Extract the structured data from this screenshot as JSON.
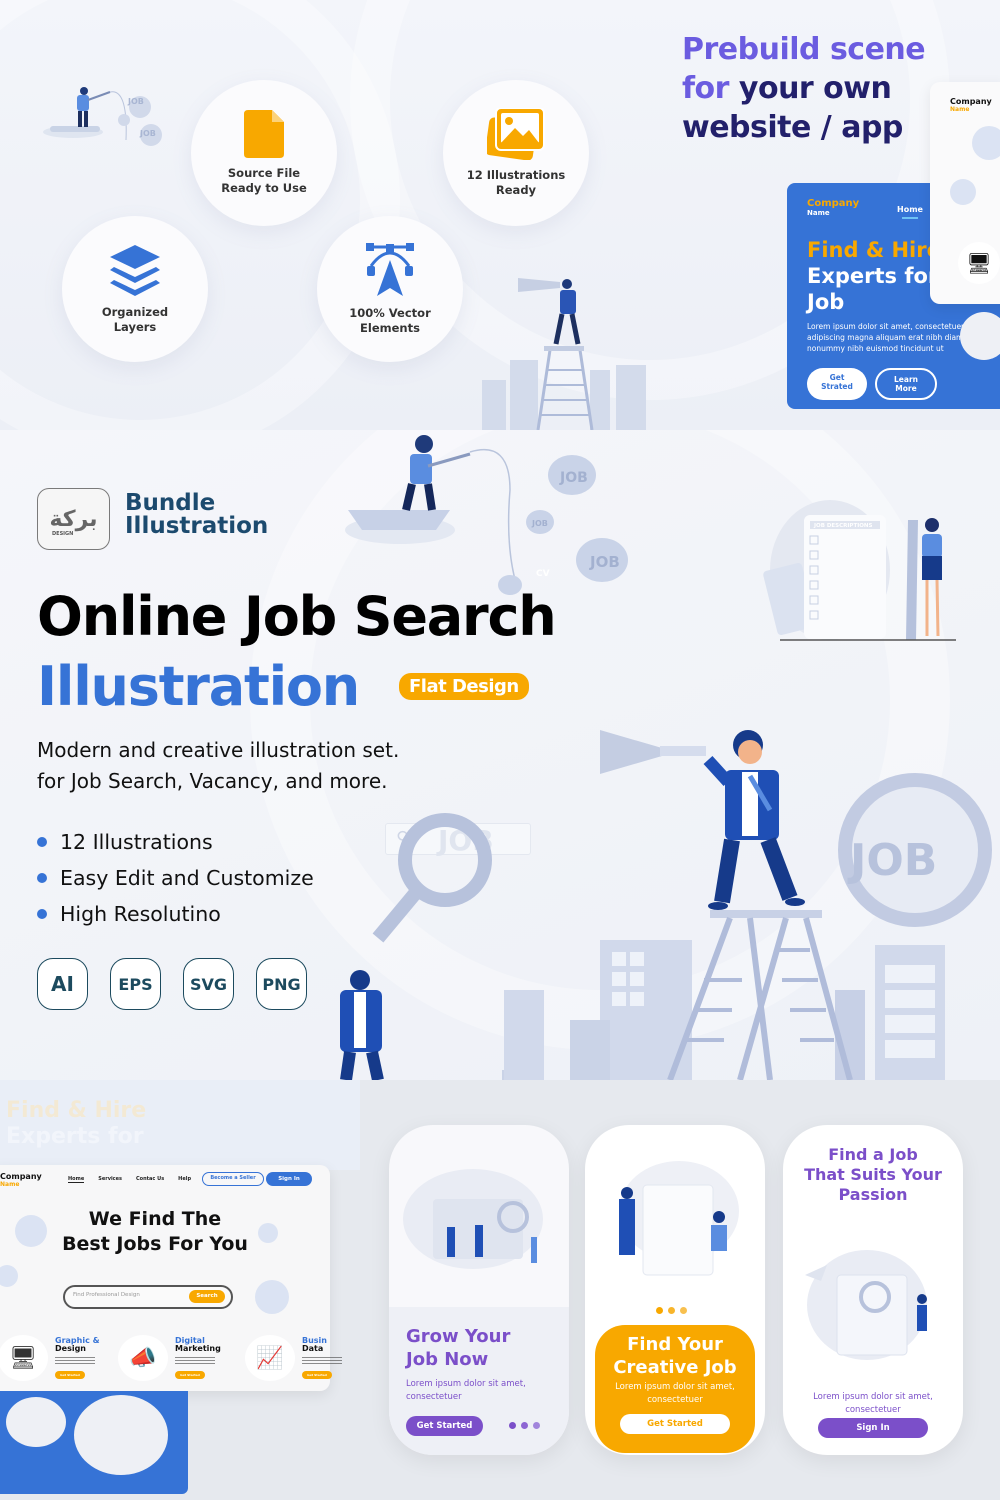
{
  "features": [
    {
      "icon": "file-icon",
      "line1": "Source File",
      "line2": "Ready to Use",
      "color": "#f8a800"
    },
    {
      "icon": "image-icon",
      "line1": "12 Illustrations",
      "line2": "Ready",
      "color": "#f8a800"
    },
    {
      "icon": "layers-icon",
      "line1": "Organized",
      "line2": "Layers",
      "color": "#3673d6"
    },
    {
      "icon": "vector-pen-icon",
      "line1": "100% Vector",
      "line2": "Elements",
      "color": "#3673d6"
    }
  ],
  "prebuild": {
    "line1": "Prebuild scene",
    "line2_accent": "for",
    "line2_rest": " your own",
    "line3": "website / app"
  },
  "hero_card": {
    "company": "Company",
    "company_sub": "Name",
    "nav_home": "Home",
    "title_orange": "Find & Hire",
    "title_white": "Experts for any Job",
    "body": "Lorem ipsum dolor sit amet, consectetuer adipiscing magna aliquam erat nibh diam nonummy nibh euismod tincidunt ut",
    "btn_primary": "Get Strated",
    "btn_secondary": "Learn More"
  },
  "side_card": {
    "company": "Company",
    "company_sub": "Name"
  },
  "brand": {
    "logo_glyph": "بركة",
    "logo_sub": "DESIGN",
    "line1": "Bundle",
    "line2": "Illustration"
  },
  "main": {
    "title": "Online Job Search",
    "subtitle": "Illustration",
    "badge": "Flat Design",
    "desc_line1": "Modern and creative illustration set.",
    "desc_line2": "for Job Search, Vacancy, and more.",
    "bullets": [
      "12 Illustrations",
      "Easy Edit and Customize",
      "High Resolutino"
    ],
    "formats": [
      "AI",
      "EPS",
      "SVG",
      "PNG"
    ]
  },
  "illustration_labels": {
    "job": "JOB",
    "cv": "CV",
    "job_descriptions": "JOB DESCRIPTIONS",
    "search_job": "JOB"
  },
  "website": {
    "company": "Company",
    "company_sub": "Name",
    "nav": [
      "Home",
      "Services",
      "Contac Us",
      "Help"
    ],
    "btn_seller": "Become a Seller",
    "btn_signin": "Sign In",
    "title_line1": "We Find The",
    "title_line2": "Best Jobs For You",
    "search_placeholder": "Find Professional Design",
    "search_btn": "Search",
    "categories": [
      {
        "t1": "Graphic &",
        "t2": "Design",
        "icon": "monitor-brush-icon",
        "btn": "Get Started"
      },
      {
        "t1": "Digital",
        "t2": "Marketing",
        "icon": "megaphone-icon",
        "btn": "Get Started"
      },
      {
        "t1": "Busin",
        "t2": "Data",
        "icon": "bar-chart-icon",
        "btn": "Get Started"
      }
    ]
  },
  "phones": [
    {
      "title1": "Grow Your",
      "title2": "Job Now",
      "body1": "Lorem ipsum dolor sit amet,",
      "body2": "consectetuer",
      "btn": "Get Started"
    },
    {
      "title1": "Find Your",
      "title2": "Creative Job",
      "body1": "Lorem ipsum dolor sit amet,",
      "body2": "consectetuer",
      "btn": "Get Started"
    },
    {
      "title1": "Find a Job",
      "title2": "That Suits Your",
      "title3": "Passion",
      "body1": "Lorem ipsum dolor sit amet,",
      "body2": "consectetuer",
      "btn": "Sign In"
    }
  ],
  "colors": {
    "blue": "#3673d6",
    "orange": "#f8a800",
    "purple": "#7b4fc9",
    "navy": "#22206b",
    "teal_dark": "#1c4a6e"
  }
}
